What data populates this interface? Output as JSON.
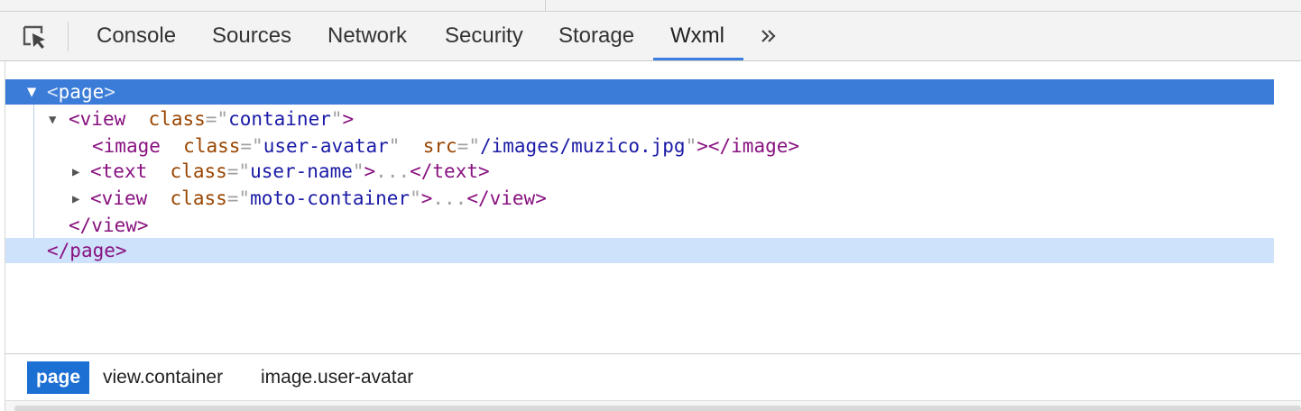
{
  "toolbar": {
    "tabs": [
      {
        "label": "Console"
      },
      {
        "label": "Sources"
      },
      {
        "label": "Network"
      },
      {
        "label": "Security"
      },
      {
        "label": "Storage"
      },
      {
        "label": "Wxml"
      }
    ],
    "active_tab": "Wxml",
    "more_label": "»"
  },
  "tree": {
    "page_tag": "page",
    "view_tag": "view",
    "view_attr": "class",
    "view_val": "container",
    "image_tag": "image",
    "image_attr1": "class",
    "image_val1": "user-avatar",
    "image_attr2": "src",
    "image_val2": "/images/muzico.jpg",
    "text_tag": "text",
    "text_attr": "class",
    "text_val": "user-name",
    "view2_tag": "view",
    "view2_attr": "class",
    "view2_val": "moto-container",
    "collapsed": "..."
  },
  "breadcrumb": {
    "items": [
      {
        "label": "page"
      },
      {
        "label": "view.container"
      },
      {
        "label": "image.user-avatar"
      }
    ]
  },
  "colors": {
    "selected_row": "#3b7cd8",
    "hover_row": "#cfe2fb",
    "tab_underline": "#3b7fe0",
    "crumb_active": "#1c6fd3"
  }
}
